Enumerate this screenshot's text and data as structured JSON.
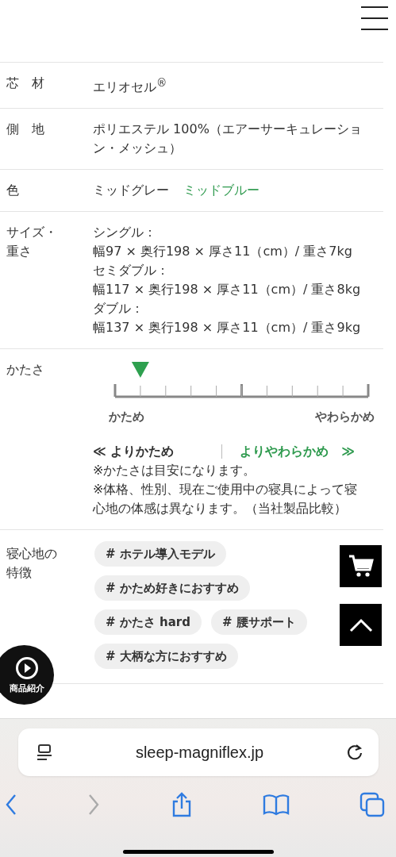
{
  "specs": [
    {
      "kind": "text",
      "label": "芯　材",
      "value": "エリオセル$^{®}$"
    },
    {
      "kind": "text",
      "label": "側　地",
      "value": "ポリエステル 100%（エアーサーキュレーション・メッシュ）"
    },
    {
      "kind": "options",
      "label": "色",
      "options": [
        {
          "text": "ミッドグレー",
          "selected": true
        },
        {
          "text": "ミッドブルー",
          "selected": false
        }
      ]
    },
    {
      "kind": "lines",
      "label": "サイズ・重さ",
      "lines": [
        "シングル：",
        "幅97 × 奥行198 × 厚さ11（cm）/ 重さ7kg",
        "セミダブル：",
        "幅117 × 奥行198 × 厚さ11（cm）/ 重さ8kg",
        "ダブル：",
        "幅137 × 奥行198 × 厚さ11（cm）/ 重さ9kg"
      ]
    },
    {
      "kind": "scale",
      "label": "かたさ",
      "level": 0.1,
      "min_label": "かため",
      "max_label": "やわらかめ",
      "links": [
        {
          "arrow": "≪",
          "text": "よりかため",
          "selected": true
        },
        {
          "arrow": "≫",
          "text": "よりやわらかめ",
          "selected": false
        }
      ],
      "notes": [
        "※かたさは目安になります。",
        "※体格、性別、現在ご使用中の寝具によって寝心地の体感は異なります。（当社製品比較）"
      ]
    },
    {
      "kind": "tags",
      "label": "寝心地の特徴",
      "tags": [
        "# ホテル導入モデル",
        "# かため好きにおすすめ",
        "# かたさ hard",
        "# 腰サポート",
        "# 大柄な方におすすめ"
      ]
    }
  ],
  "video_button": {
    "label": "商品紹介"
  },
  "browser": {
    "url": "sleep-magniflex.jp",
    "forward_disabled": true
  }
}
